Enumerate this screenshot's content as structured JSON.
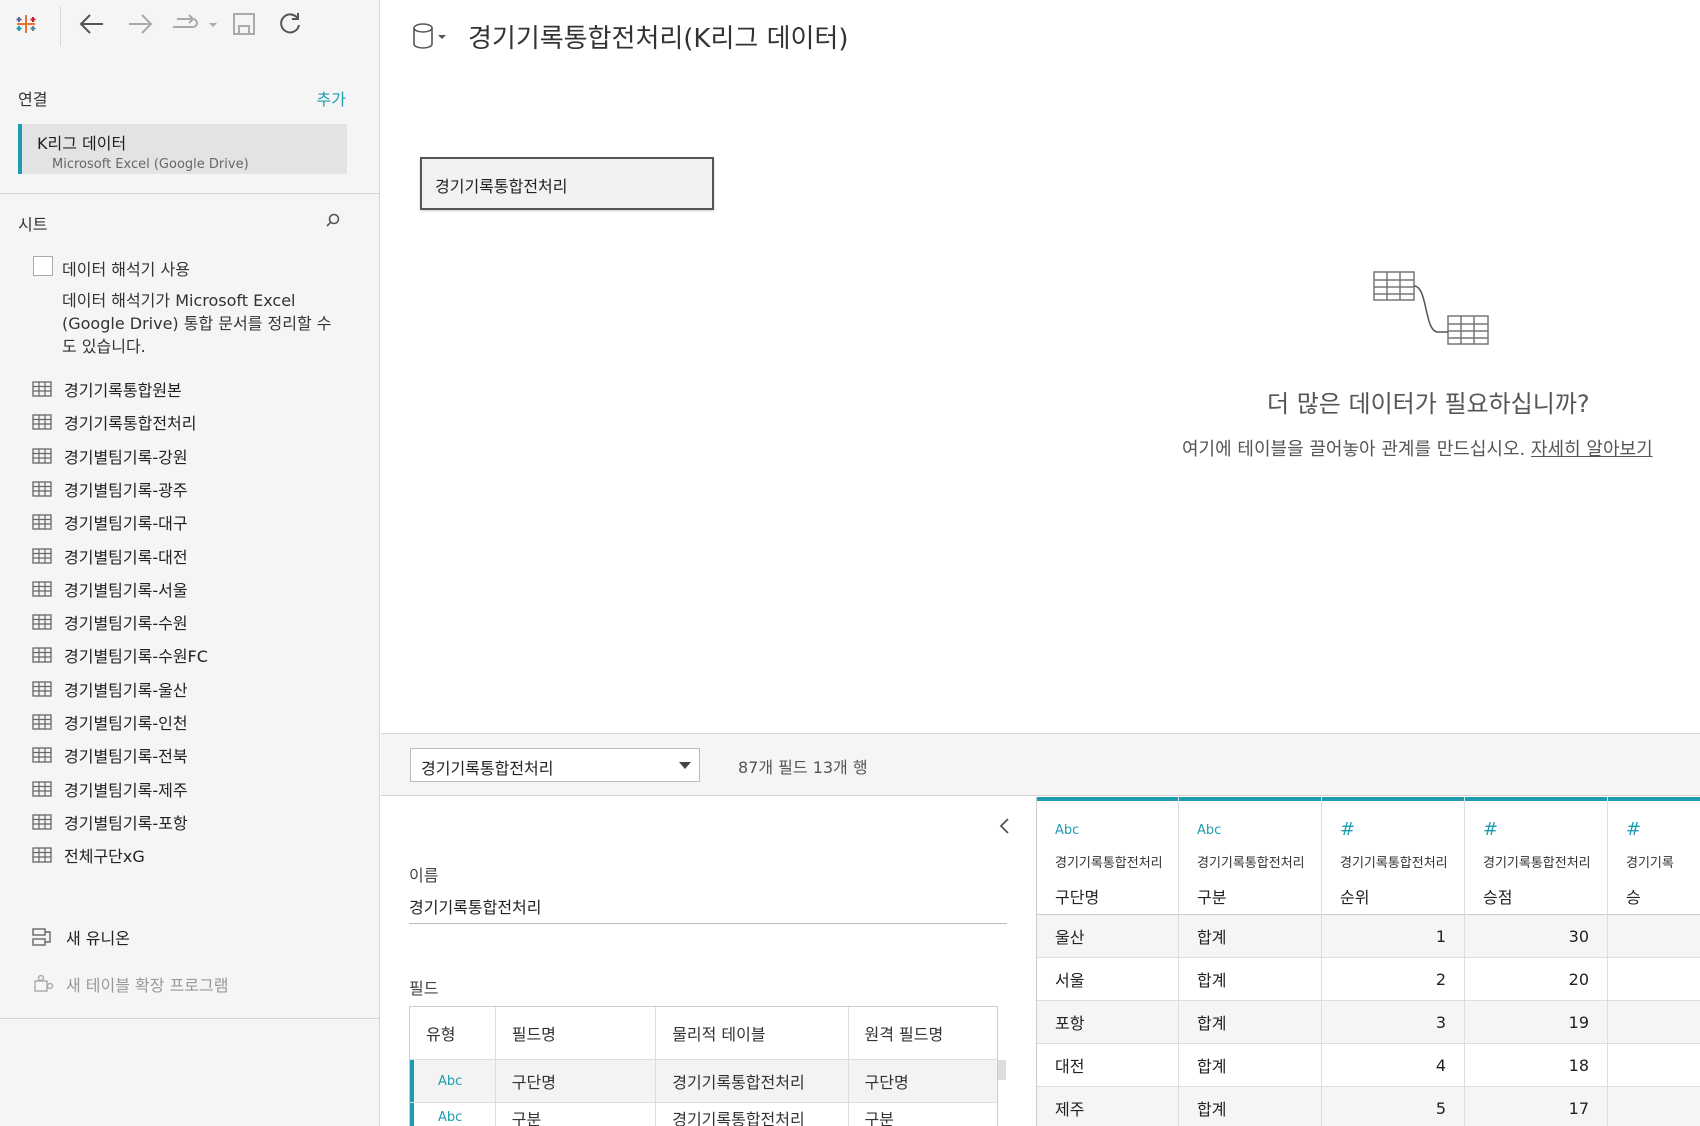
{
  "sidebar": {
    "connections_label": "연결",
    "add_label": "추가",
    "connection": {
      "name": "K리그 데이터",
      "source": "Microsoft Excel (Google Drive)"
    },
    "sheets_label": "시트",
    "interpreter": {
      "label": "데이터 해석기 사용",
      "description": "데이터 해석기가 Microsoft Excel (Google Drive) 통합 문서를 정리할 수도 있습니다."
    },
    "sheets": [
      "경기기록통합원본",
      "경기기록통합전처리",
      "경기별팀기록-강원",
      "경기별팀기록-광주",
      "경기별팀기록-대구",
      "경기별팀기록-대전",
      "경기별팀기록-서울",
      "경기별팀기록-수원",
      "경기별팀기록-수원FC",
      "경기별팀기록-울산",
      "경기별팀기록-인천",
      "경기별팀기록-전북",
      "경기별팀기록-제주",
      "경기별팀기록-포항",
      "전체구단xG"
    ],
    "new_union": "새 유니온",
    "new_extension": "새 테이블 확장 프로그램"
  },
  "header": {
    "title": "경기기록통합전처리(K리그 데이터)"
  },
  "canvas": {
    "table_name": "경기기록통합전처리",
    "more_data_title": "더 많은 데이터가 필요하십니까?",
    "more_data_desc": "여기에 테이블을 끌어놓아 관계를 만드십시오.",
    "more_data_link": "자세히 알아보기"
  },
  "bottom": {
    "table_select": "경기기록통합전처리",
    "counts": "87개 필드 13개 행"
  },
  "details": {
    "name_label": "이름",
    "name_value": "경기기록통합전처리",
    "fields_label": "필드",
    "columns": [
      "유형",
      "필드명",
      "물리적 테이블",
      "원격 필드명"
    ],
    "rows": [
      {
        "type": "Abc",
        "field": "구단명",
        "table": "경기기록통합전처리",
        "remote": "구단명"
      },
      {
        "type": "Abc",
        "field": "구분",
        "table": "경기기록통합전처리",
        "remote": "구분"
      }
    ]
  },
  "grid": {
    "columns": [
      {
        "type": "Abc",
        "source": "경기기록통합전처리",
        "field": "구단명"
      },
      {
        "type": "#",
        "source": "경기기록통합전처리",
        "field": "구분",
        "type_override": "Abc"
      },
      {
        "type": "#",
        "source": "경기기록통합전처리",
        "field": "순위"
      },
      {
        "type": "#",
        "source": "경기기록통합전처리",
        "field": "승점"
      },
      {
        "type": "#",
        "source": "경기기록",
        "field": "승"
      }
    ],
    "rows": [
      [
        "울산",
        "합계",
        "1",
        "30",
        ""
      ],
      [
        "서울",
        "합계",
        "2",
        "20",
        ""
      ],
      [
        "포항",
        "합계",
        "3",
        "19",
        ""
      ],
      [
        "대전",
        "합계",
        "4",
        "18",
        ""
      ],
      [
        "제주",
        "합계",
        "5",
        "17",
        ""
      ]
    ]
  },
  "colors": {
    "accent": "#1f9db0"
  }
}
